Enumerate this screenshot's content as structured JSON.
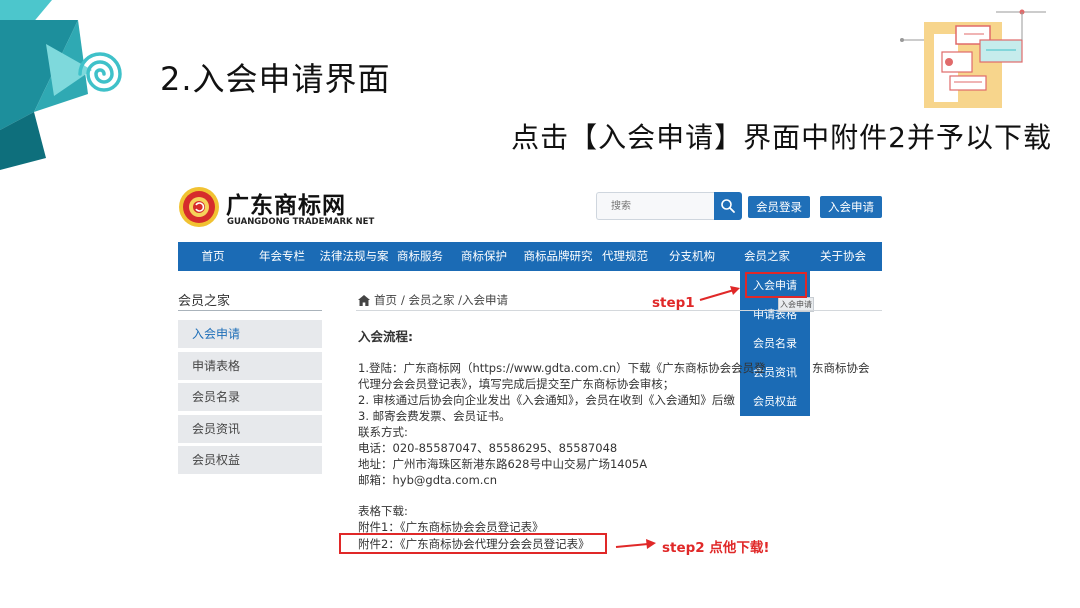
{
  "slide": {
    "title": "2.入会申请界面",
    "subtitle": "点击【入会申请】界面中附件2并予以下载"
  },
  "site": {
    "logo": {
      "name_cn": "广东商标网",
      "name_en": "GUANGDONG TRADEMARK NET"
    },
    "search": {
      "placeholder": "搜索"
    },
    "buttons": {
      "login": "会员登录",
      "apply": "入会申请"
    },
    "nav": [
      {
        "label": "首页"
      },
      {
        "label": "年会专栏"
      },
      {
        "label": "法律法规与案"
      },
      {
        "label": "商标服务"
      },
      {
        "label": "商标保护"
      },
      {
        "label": "商标品牌研究"
      },
      {
        "label": "代理规范"
      },
      {
        "label": "分支机构"
      },
      {
        "label": "会员之家"
      },
      {
        "label": "关于协会"
      }
    ],
    "dropdown": {
      "items": [
        {
          "label": "入会申请"
        },
        {
          "label": "申请表格"
        },
        {
          "label": "会员名录"
        },
        {
          "label": "会员资讯"
        },
        {
          "label": "会员权益"
        }
      ],
      "tooltip": "入会申请"
    },
    "sidebar": {
      "title": "会员之家",
      "items": [
        {
          "label": "入会申请"
        },
        {
          "label": "申请表格"
        },
        {
          "label": "会员名录"
        },
        {
          "label": "会员资讯"
        },
        {
          "label": "会员权益"
        }
      ]
    },
    "breadcrumb": {
      "home": "首页",
      "path": "/ 会员之家 /入会申请"
    },
    "content": {
      "heading": "入会流程:",
      "step1_line1": "1.登陆：广东商标网（https://www.gdta.com.cn）下载《广东商标协会会员登",
      "step1_line1_tail": "东商标协会",
      "step1_line2": "代理分会会员登记表》，填写完成后提交至广东商标协会审核；",
      "step2": "2. 审核通过后协会向企业发出《入会通知》，会员在收到《入会通知》后缴",
      "step3": "3. 邮寄会费发票、会员证书。",
      "contact_label": "联系方式:",
      "phone": "电话：020-85587047、85586295、85587048",
      "address": "地址：广州市海珠区新港东路628号中山交易广场1405A",
      "email": "邮箱：hyb@gdta.com.cn",
      "downloads_label": "表格下载:",
      "attachment1": "附件1：《广东商标协会会员登记表》",
      "attachment2": "附件2：《广东商标协会代理分会会员登记表》"
    }
  },
  "annotations": {
    "step1": "step1",
    "step2": "step2 点他下载!",
    "color": "#e02828"
  },
  "colors": {
    "brand_blue": "#1b6bb5",
    "accent_teal": "#3fc1c9",
    "sidebar_bg": "#e7e9ec"
  }
}
